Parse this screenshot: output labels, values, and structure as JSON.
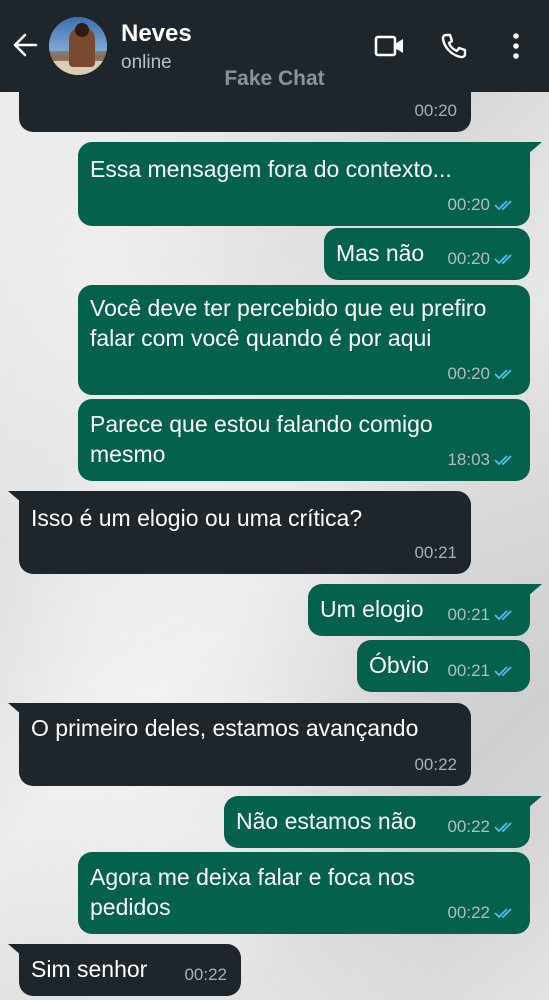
{
  "header": {
    "contact_name": "Neves",
    "status": "online",
    "watermark": "Fake Chat",
    "icons": [
      "back-arrow-icon",
      "video-call-icon",
      "phone-icon",
      "more-options-icon"
    ]
  },
  "colors": {
    "header_bg": "#1f262b",
    "incoming_bubble": "#1f262b",
    "outgoing_bubble": "#03614c",
    "read_ticks": "#53bdeb"
  },
  "messages": [
    {
      "direction": "in",
      "text": "",
      "time": "00:20",
      "read": false
    },
    {
      "direction": "out",
      "lines": [
        "Essa mensagem fora do contexto..."
      ],
      "time": "00:20",
      "read": true
    },
    {
      "direction": "out",
      "lines": [
        "Mas não"
      ],
      "time": "00:20",
      "read": true
    },
    {
      "direction": "out",
      "lines": [
        "Você deve ter percebido que eu prefiro",
        "falar com você quando é por aqui"
      ],
      "time": "00:20",
      "read": true
    },
    {
      "direction": "out",
      "lines": [
        "Parece que estou falando comigo",
        "mesmo"
      ],
      "time": "18:03",
      "read": true
    },
    {
      "direction": "in",
      "lines": [
        "Isso é um elogio ou uma crítica?"
      ],
      "time": "00:21",
      "read": false
    },
    {
      "direction": "out",
      "lines": [
        "Um elogio"
      ],
      "time": "00:21",
      "read": true
    },
    {
      "direction": "out",
      "lines": [
        "Óbvio"
      ],
      "time": "00:21",
      "read": true
    },
    {
      "direction": "in",
      "lines": [
        "O primeiro deles, estamos avançando"
      ],
      "time": "00:22",
      "read": false
    },
    {
      "direction": "out",
      "lines": [
        "Não estamos não"
      ],
      "time": "00:22",
      "read": true
    },
    {
      "direction": "out",
      "lines": [
        "Agora me deixa falar e foca nos",
        "pedidos"
      ],
      "time": "00:22",
      "read": true
    },
    {
      "direction": "in",
      "lines": [
        "Sim senhor"
      ],
      "time": "00:22",
      "read": false
    }
  ]
}
